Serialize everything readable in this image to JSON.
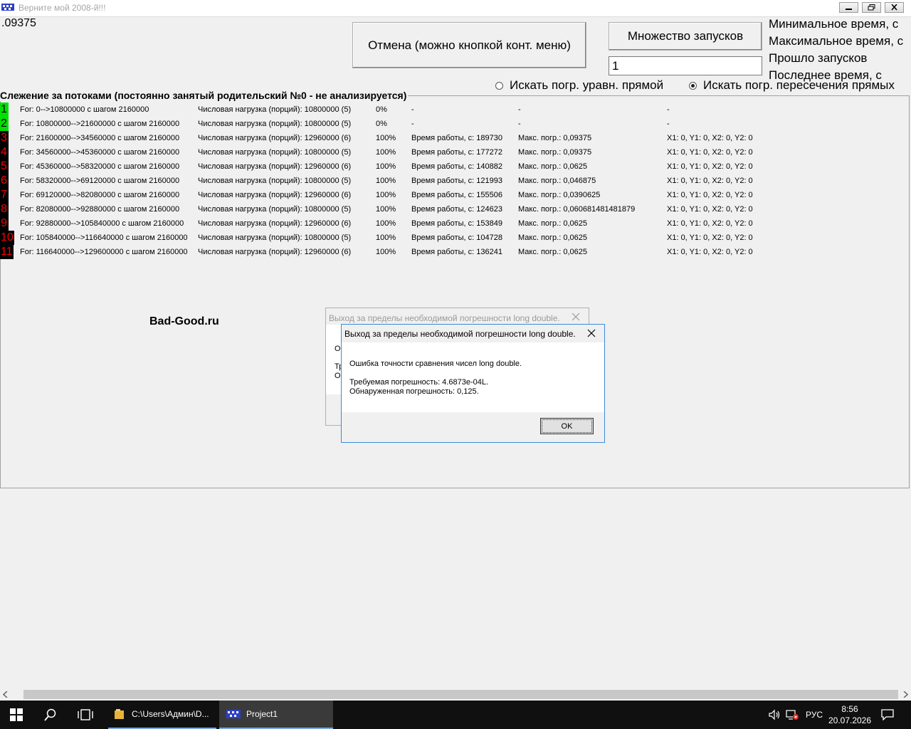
{
  "window": {
    "title": "Верните мой 2008-й!!!"
  },
  "readout": ".09375",
  "buttons": {
    "cancel": "Отмена (можно кнопкой конт. меню)",
    "multi_run": "Множество запусков"
  },
  "runs_input_value": "1",
  "stats": {
    "min_time": "Минимальное время, с",
    "max_time": "Максимальное время, с",
    "runs_passed": "Прошло запусков",
    "last_time": "Последнее время, с"
  },
  "radios": {
    "line_eq": {
      "label": "Искать погр. уравн. прямой",
      "checked": false
    },
    "line_cross": {
      "label": "Искать погр. пересечения прямых",
      "checked": true
    }
  },
  "group_caption": "Слежение за потоками (постоянно занятый родительский №0 - не анализируется)",
  "threads": [
    {
      "num": "1",
      "state": "active",
      "range": "For: 0-->10800000 с шагом 2160000",
      "load": "Числовая нагрузка (порций): 10800000 (5)",
      "pct": "0%",
      "time": "-",
      "err": "-",
      "coords": "-"
    },
    {
      "num": "2",
      "state": "active",
      "range": "For: 10800000-->21600000 с шагом 2160000",
      "load": "Числовая нагрузка (порций): 10800000 (5)",
      "pct": "0%",
      "time": "-",
      "err": "-",
      "coords": "-"
    },
    {
      "num": "3",
      "state": "done",
      "range": "For: 21600000-->34560000 с шагом 2160000",
      "load": "Числовая нагрузка (порций): 12960000 (6)",
      "pct": "100%",
      "time": "Время работы, с: 189730",
      "err": "Макс. погр.: 0,09375",
      "coords": "X1: 0, Y1: 0, X2: 0, Y2: 0"
    },
    {
      "num": "4",
      "state": "done",
      "range": "For: 34560000-->45360000 с шагом 2160000",
      "load": "Числовая нагрузка (порций): 10800000 (5)",
      "pct": "100%",
      "time": "Время работы, с: 177272",
      "err": "Макс. погр.: 0,09375",
      "coords": "X1: 0, Y1: 0, X2: 0, Y2: 0"
    },
    {
      "num": "5",
      "state": "done",
      "range": "For: 45360000-->58320000 с шагом 2160000",
      "load": "Числовая нагрузка (порций): 12960000 (6)",
      "pct": "100%",
      "time": "Время работы, с: 140882",
      "err": "Макс. погр.: 0,0625",
      "coords": "X1: 0, Y1: 0, X2: 0, Y2: 0"
    },
    {
      "num": "6",
      "state": "done",
      "range": "For: 58320000-->69120000 с шагом 2160000",
      "load": "Числовая нагрузка (порций): 10800000 (5)",
      "pct": "100%",
      "time": "Время работы, с: 121993",
      "err": "Макс. погр.: 0,046875",
      "coords": "X1: 0, Y1: 0, X2: 0, Y2: 0"
    },
    {
      "num": "7",
      "state": "done",
      "range": "For: 69120000-->82080000 с шагом 2160000",
      "load": "Числовая нагрузка (порций): 12960000 (6)",
      "pct": "100%",
      "time": "Время работы, с: 155506",
      "err": "Макс. погр.: 0,0390625",
      "coords": "X1: 0, Y1: 0, X2: 0, Y2: 0"
    },
    {
      "num": "8",
      "state": "done",
      "range": "For: 82080000-->92880000 с шагом 2160000",
      "load": "Числовая нагрузка (порций): 10800000 (5)",
      "pct": "100%",
      "time": "Время работы, с: 124623",
      "err": "Макс. погр.: 0,060681481481879",
      "coords": "X1: 0, Y1: 0, X2: 0, Y2: 0"
    },
    {
      "num": "9",
      "state": "done",
      "range": "For: 92880000-->105840000 с шагом 2160000",
      "load": "Числовая нагрузка (порций): 12960000 (6)",
      "pct": "100%",
      "time": "Время работы, с: 153849",
      "err": "Макс. погр.: 0,0625",
      "coords": "X1: 0, Y1: 0, X2: 0, Y2: 0"
    },
    {
      "num": "10",
      "state": "done",
      "range": "For: 105840000-->116640000 с шагом 2160000",
      "load": "Числовая нагрузка (порций): 10800000 (5)",
      "pct": "100%",
      "time": "Время работы, с: 104728",
      "err": "Макс. погр.: 0,0625",
      "coords": "X1: 0, Y1: 0, X2: 0, Y2: 0"
    },
    {
      "num": "11",
      "state": "done",
      "range": "For: 116640000-->129600000 с шагом 2160000",
      "load": "Числовая нагрузка (порций): 12960000 (6)",
      "pct": "100%",
      "time": "Время работы, с: 136241",
      "err": "Макс. погр.: 0,0625",
      "coords": "X1: 0, Y1: 0, X2: 0, Y2: 0"
    }
  ],
  "watermark": "Bad-Good.ru",
  "dialog": {
    "title": "Выход за пределы необходимой погрешности long double.",
    "message": "Ошибка точности сравнения чисел long double.",
    "required": "Требуемая погрешность: 4.6873e-04L.",
    "found": "Обнаруженная погрешность: 0,125.",
    "ok": "OK"
  },
  "back_dialog": {
    "title": "Выход за пределы необходимой погрешности long double.",
    "fragment1": "О",
    "fragment2": "Тр",
    "fragment3": "О"
  },
  "taskbar": {
    "explorer_task": "C:\\Users\\Админ\\D...",
    "app_task": "Project1",
    "language": "РУС",
    "time": "8:56",
    "date": "20.07.2026"
  },
  "colors": {
    "done_bg": "#000000",
    "active_bg": "#00e000",
    "num_red": "#ff0000",
    "dialog_border": "#3a8bd8"
  }
}
